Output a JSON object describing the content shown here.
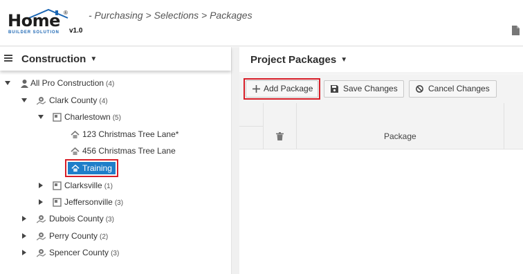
{
  "header": {
    "logo_word": "Home",
    "logo_registered": "®",
    "logo_subtitle": "BUILDER SOLUTION",
    "version": "v1.0",
    "breadcrumb": "- Purchasing > Selections > Packages"
  },
  "left_panel": {
    "title": "Construction",
    "tree": [
      {
        "label": "All Pro Construction",
        "count": "(4)",
        "icon": "person-icon",
        "toggle": "expanded"
      },
      {
        "label": "Clark County",
        "count": "(4)",
        "icon": "map-pin-icon",
        "toggle": "expanded"
      },
      {
        "label": "Charlestown",
        "count": "(5)",
        "icon": "subdivision-icon",
        "toggle": "expanded"
      },
      {
        "label": "123 Christmas Tree Lane*",
        "count": "",
        "icon": "house-icon",
        "toggle": "none"
      },
      {
        "label": "456 Christmas Tree Lane",
        "count": "",
        "icon": "house-icon",
        "toggle": "none"
      },
      {
        "label": "Training",
        "count": "",
        "icon": "house-icon",
        "toggle": "none",
        "selected": true
      },
      {
        "label": "Clarksville",
        "count": "(1)",
        "icon": "subdivision-icon",
        "toggle": "collapsed"
      },
      {
        "label": "Jeffersonville",
        "count": "(3)",
        "icon": "subdivision-icon",
        "toggle": "collapsed"
      },
      {
        "label": "Dubois County",
        "count": "(3)",
        "icon": "map-pin-icon",
        "toggle": "collapsed"
      },
      {
        "label": "Perry County",
        "count": "(2)",
        "icon": "map-pin-icon",
        "toggle": "collapsed"
      },
      {
        "label": "Spencer County",
        "count": "(3)",
        "icon": "map-pin-icon",
        "toggle": "collapsed"
      }
    ]
  },
  "right_panel": {
    "title": "Project Packages",
    "toolbar": {
      "add_label": "Add Package",
      "save_label": "Save Changes",
      "cancel_label": "Cancel Changes"
    },
    "grid": {
      "columns": [
        "",
        "",
        "Package"
      ]
    }
  },
  "colors": {
    "selection": "#1f7ec9",
    "highlight": "#d71e28",
    "brand_blue": "#1b66b3"
  }
}
